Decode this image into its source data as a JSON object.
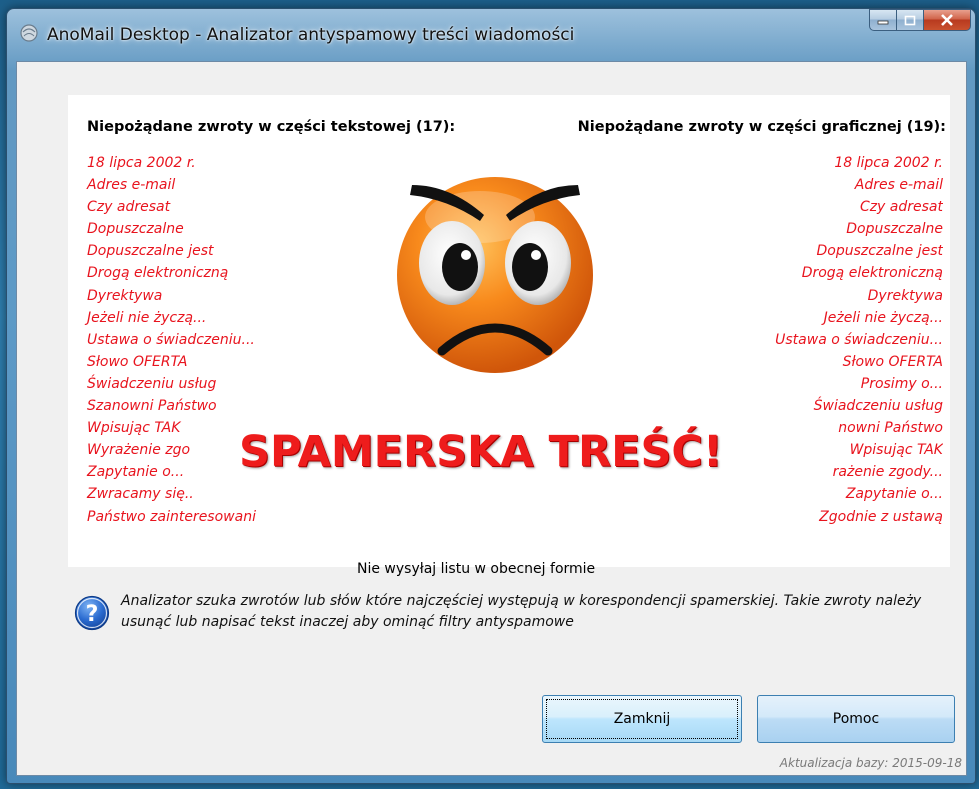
{
  "window": {
    "title": "AnoMail Desktop - Analizator antyspamowy treści wiadomości"
  },
  "left_column": {
    "heading": "Niepożądane zwroty w części tekstowej (17):",
    "items": [
      "18 lipca 2002 r.",
      "Adres e-mail",
      "Czy adresat",
      "Dopuszczalne",
      "Dopuszczalne jest",
      "Drogą elektroniczną",
      "Dyrektywa",
      "Jeżeli nie życzą...",
      "Ustawa o świadczeniu...",
      "Słowo OFERTA",
      "Świadczeniu usług",
      "Szanowni Państwo",
      "Wpisując TAK",
      "Wyrażenie zgo",
      "Zapytanie o...",
      "Zwracamy się..",
      "Państwo zainteresowani"
    ]
  },
  "right_column": {
    "heading": "Niepożądane zwroty w części graficznej (19):",
    "items": [
      "18 lipca 2002 r.",
      "Adres e-mail",
      "Czy adresat",
      "Dopuszczalne",
      "Dopuszczalne jest",
      "Drogą elektroniczną",
      "Dyrektywa",
      "Jeżeli nie życzą...",
      "Ustawa o świadczeniu...",
      "Słowo OFERTA",
      "Prosimy o...",
      "Świadczeniu usług",
      "nowni Państwo",
      "Wpisując TAK",
      "rażenie zgody...",
      "Zapytanie o...",
      "Zgodnie z ustawą"
    ]
  },
  "verdict": {
    "title": "SPAMERSKA TREŚĆ!",
    "warning": "Nie wysyłaj listu w obecnej formie"
  },
  "info": {
    "text": "Analizator szuka zwrotów lub słów które najczęściej występują w korespondencji spamerskiej. Takie zwroty należy usunąć lub napisać tekst inaczej aby ominąć filtry antyspamowe"
  },
  "buttons": {
    "close": "Zamknij",
    "help": "Pomoc"
  },
  "footer": {
    "update": "Aktualizacja bazy: 2015-09-18"
  },
  "colors": {
    "spam_red": "#ee1c1c",
    "phrase_red": "#e8141e",
    "face_orange": "#f47a16"
  },
  "icons": {
    "app": "mail-globe-icon",
    "help": "question-icon",
    "face": "angry-face-icon"
  }
}
